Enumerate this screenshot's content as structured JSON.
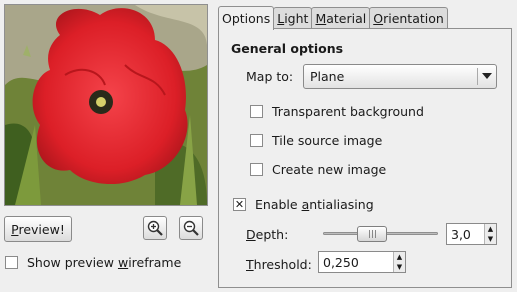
{
  "preview": {
    "button_label_pre": "",
    "button_mnemonic": "P",
    "button_label_post": "review!",
    "wireframe_label_pre": "Show preview ",
    "wireframe_mnemonic": "w",
    "wireframe_label_post": "ireframe",
    "wireframe_checked": false,
    "zoom_in_icon": "zoom-in-icon",
    "zoom_out_icon": "zoom-out-icon"
  },
  "tabs": [
    {
      "label": "Options",
      "mnemonic_index": -1,
      "active": true
    },
    {
      "label": "Light",
      "mnemonic_index": 0,
      "active": false
    },
    {
      "label": "Material",
      "mnemonic_index": 0,
      "active": false
    },
    {
      "label": "Orientation",
      "mnemonic_index": 0,
      "active": false
    }
  ],
  "general": {
    "title": "General options",
    "map_to_label": "Map to:",
    "map_to_value": "Plane",
    "transparent_background": {
      "label": "Transparent background",
      "checked": false
    },
    "tile_source": {
      "label": "Tile source image",
      "checked": false
    },
    "create_new": {
      "label": "Create new image",
      "checked": false
    },
    "antialias_pre": "Enable ",
    "antialias_mnemonic": "a",
    "antialias_post": "ntialiasing",
    "antialias_checked": true,
    "depth_label_pre": "",
    "depth_mnemonic": "D",
    "depth_label_post": "epth:",
    "depth_value": "3,0",
    "depth_slider_fraction": 0.4,
    "threshold_mnemonic": "T",
    "threshold_label_post": "hreshold:",
    "threshold_value": "0,250"
  },
  "colors": {
    "poppy": "#e0242b",
    "poppy_dark": "#9c1318",
    "foliage": "#5d7a2e"
  }
}
